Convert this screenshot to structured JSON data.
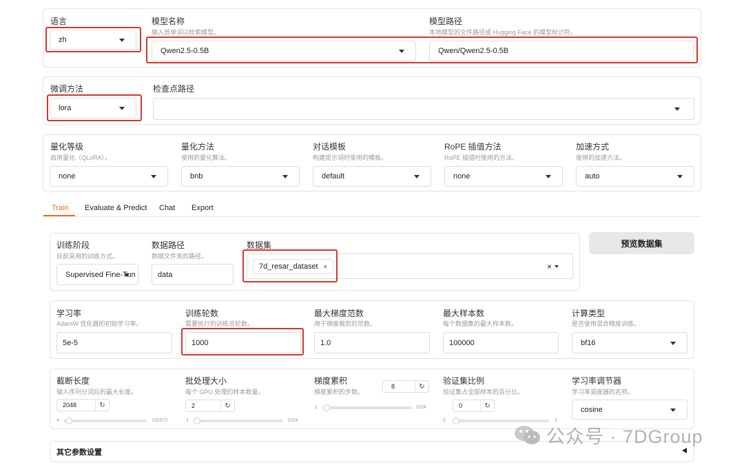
{
  "top": {
    "lang": {
      "label": "语言",
      "value": "zh"
    },
    "model_name": {
      "label": "模型名称",
      "hint": "输入首单词以检索模型。",
      "value": "Qwen2.5-0.5B"
    },
    "model_path": {
      "label": "模型路径",
      "hint": "本地模型的文件路径或 Hugging Face 的模型标识符。",
      "value": "Qwen/Qwen2.5-0.5B"
    }
  },
  "finetune": {
    "method": {
      "label": "微调方法",
      "value": "lora"
    },
    "checkpoint": {
      "label": "检查点路径",
      "value": ""
    }
  },
  "quant": {
    "bits": {
      "label": "量化等级",
      "hint": "启用量化（QLoRA）。",
      "value": "none"
    },
    "method": {
      "label": "量化方法",
      "hint": "使用的量化算法。",
      "value": "bnb"
    },
    "template": {
      "label": "对话模板",
      "hint": "构建提示词时使用的模板。",
      "value": "default"
    },
    "rope": {
      "label": "RoPE 插值方法",
      "hint": "RoPE 插值时使用的方法。",
      "value": "none"
    },
    "booster": {
      "label": "加速方式",
      "hint": "使用的加速方法。",
      "value": "auto"
    }
  },
  "tabs": [
    "Train",
    "Evaluate & Predict",
    "Chat",
    "Export"
  ],
  "train": {
    "stage": {
      "label": "训练阶段",
      "hint": "目前采用的训练方式。",
      "value": "Supervised Fine-Tun"
    },
    "dataset_dir": {
      "label": "数据路径",
      "hint": "数据文件夹的路径。",
      "value": "data"
    },
    "dataset": {
      "label": "数据集",
      "chip": "7d_resar_dataset",
      "chip_close": "×",
      "clear": "×"
    },
    "preview_button": "预览数据集"
  },
  "params": {
    "lr": {
      "label": "学习率",
      "hint": "AdamW 优化器的初始学习率。",
      "value": "5e-5"
    },
    "epochs": {
      "label": "训练轮数",
      "hint": "需要执行的训练总轮数。",
      "value": "1000"
    },
    "grad_norm": {
      "label": "最大梯度范数",
      "hint": "用于梯度裁剪的范数。",
      "value": "1.0"
    },
    "max_samples": {
      "label": "最大样本数",
      "hint": "每个数据集的最大样本数。",
      "value": "100000"
    },
    "compute_type": {
      "label": "计算类型",
      "hint": "是否使用混合精度训练。",
      "value": "bf16"
    }
  },
  "sliders": {
    "cutoff": {
      "label": "截断长度",
      "hint": "输入序列分词后的最大长度。",
      "value": "2048",
      "min": "4",
      "max": "131072",
      "fraction": 0.015
    },
    "batch": {
      "label": "批处理大小",
      "hint": "每个 GPU 处理的样本数量。",
      "value": "2",
      "min": "1",
      "max": "1024",
      "fraction": 0.001
    },
    "grad_accum": {
      "label": "梯度累积",
      "hint": "梯度累积的步数。",
      "value": "8",
      "min": "1",
      "max": "1024",
      "fraction": 0.007
    },
    "val_size": {
      "label": "验证集比例",
      "hint": "验证集占全部样本的百分比。",
      "value": "0",
      "min": "0",
      "max": "1",
      "fraction": 0
    },
    "scheduler": {
      "label": "学习率调节器",
      "hint": "学习率调度器的名称。",
      "value": "cosine"
    }
  },
  "reset_glyph": "↻",
  "other_settings": "其它参数设置",
  "watermark": "公众号 · 7DGroup",
  "colors": {
    "accent": "#e8731a",
    "highlight": "#d9342b"
  }
}
